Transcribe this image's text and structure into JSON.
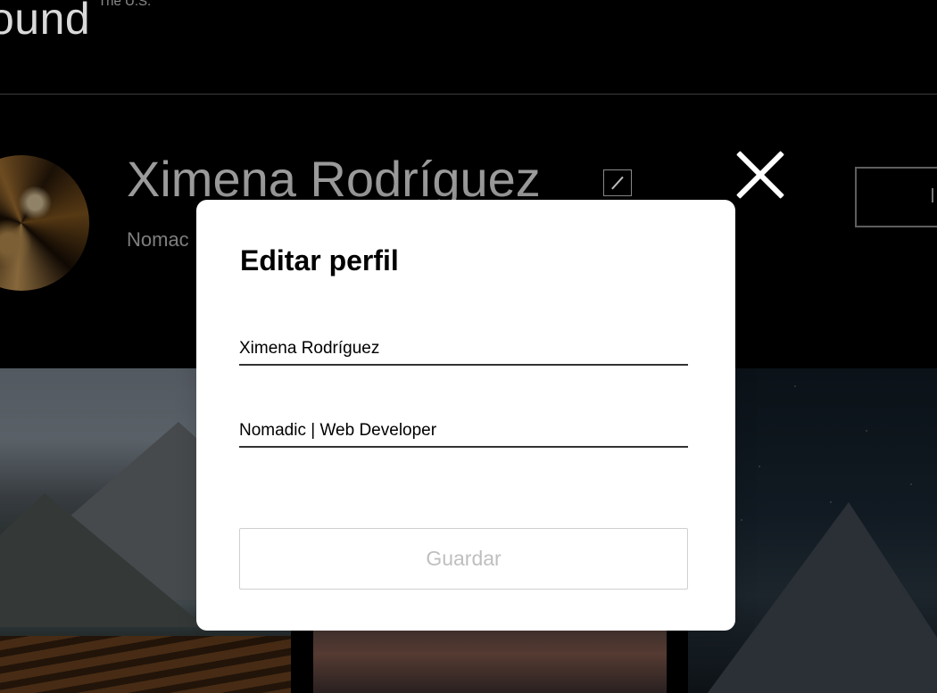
{
  "header": {
    "logo_text": "ound",
    "logo_sub": "The U.S."
  },
  "profile": {
    "name": "Ximena Rodríguez",
    "bio": "Nomadic | Web Developer",
    "bio_visible": "Nomac"
  },
  "modal": {
    "title": "Editar perfil",
    "name_value": "Ximena Rodríguez",
    "bio_value": "Nomadic | Web Developer",
    "save_label": "Guardar",
    "save_disabled": true
  },
  "colors": {
    "page_background": "#000000",
    "modal_background": "#ffffff",
    "save_disabled_text": "#bfbfbf"
  },
  "icons": {
    "close": "close-icon",
    "edit": "pencil-icon"
  }
}
